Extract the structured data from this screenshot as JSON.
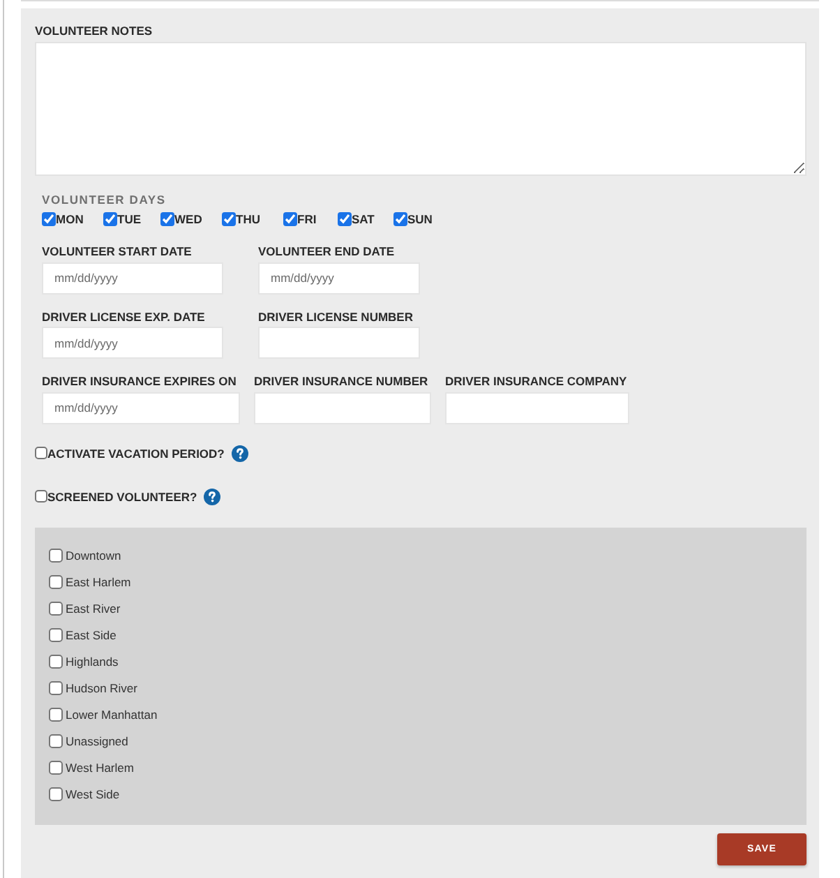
{
  "notes": {
    "label": "VOLUNTEER NOTES"
  },
  "days": {
    "label": "VOLUNTEER DAYS",
    "items": [
      {
        "label": "MON",
        "checked": true
      },
      {
        "label": "TUE",
        "checked": true
      },
      {
        "label": "WED",
        "checked": true
      },
      {
        "label": "THU",
        "checked": true
      },
      {
        "label": "FRI",
        "checked": true
      },
      {
        "label": "SAT",
        "checked": true
      },
      {
        "label": "SUN",
        "checked": true
      }
    ]
  },
  "field_rows": [
    {
      "fields": [
        {
          "label": "VOLUNTEER START DATE",
          "placeholder": "mm/dd/yyyy"
        },
        {
          "label": "VOLUNTEER END DATE",
          "placeholder": "mm/dd/yyyy"
        }
      ]
    },
    {
      "fields": [
        {
          "label": "DRIVER LICENSE EXP. DATE",
          "placeholder": "mm/dd/yyyy"
        },
        {
          "label": "DRIVER LICENSE NUMBER"
        }
      ]
    },
    {
      "fields": [
        {
          "label": "DRIVER INSURANCE EXPIRES ON",
          "placeholder": "mm/dd/yyyy"
        },
        {
          "label": "DRIVER INSURANCE NUMBER"
        },
        {
          "label": "DRIVER INSURANCE COMPANY"
        }
      ]
    }
  ],
  "toggles": [
    {
      "label": "ACTIVATE VACATION PERIOD?",
      "checked": false
    },
    {
      "label": "SCREENED VOLUNTEER?",
      "checked": false
    }
  ],
  "neighborhoods": [
    {
      "label": "Downtown",
      "checked": false
    },
    {
      "label": "East Harlem",
      "checked": false
    },
    {
      "label": "East River",
      "checked": false
    },
    {
      "label": "East Side",
      "checked": false
    },
    {
      "label": "Highlands",
      "checked": false
    },
    {
      "label": "Hudson River",
      "checked": false
    },
    {
      "label": "Lower Manhattan",
      "checked": false
    },
    {
      "label": "Unassigned",
      "checked": false
    },
    {
      "label": "West Harlem",
      "checked": false
    },
    {
      "label": "West Side",
      "checked": false
    }
  ],
  "save_button": {
    "label": "SAVE"
  }
}
